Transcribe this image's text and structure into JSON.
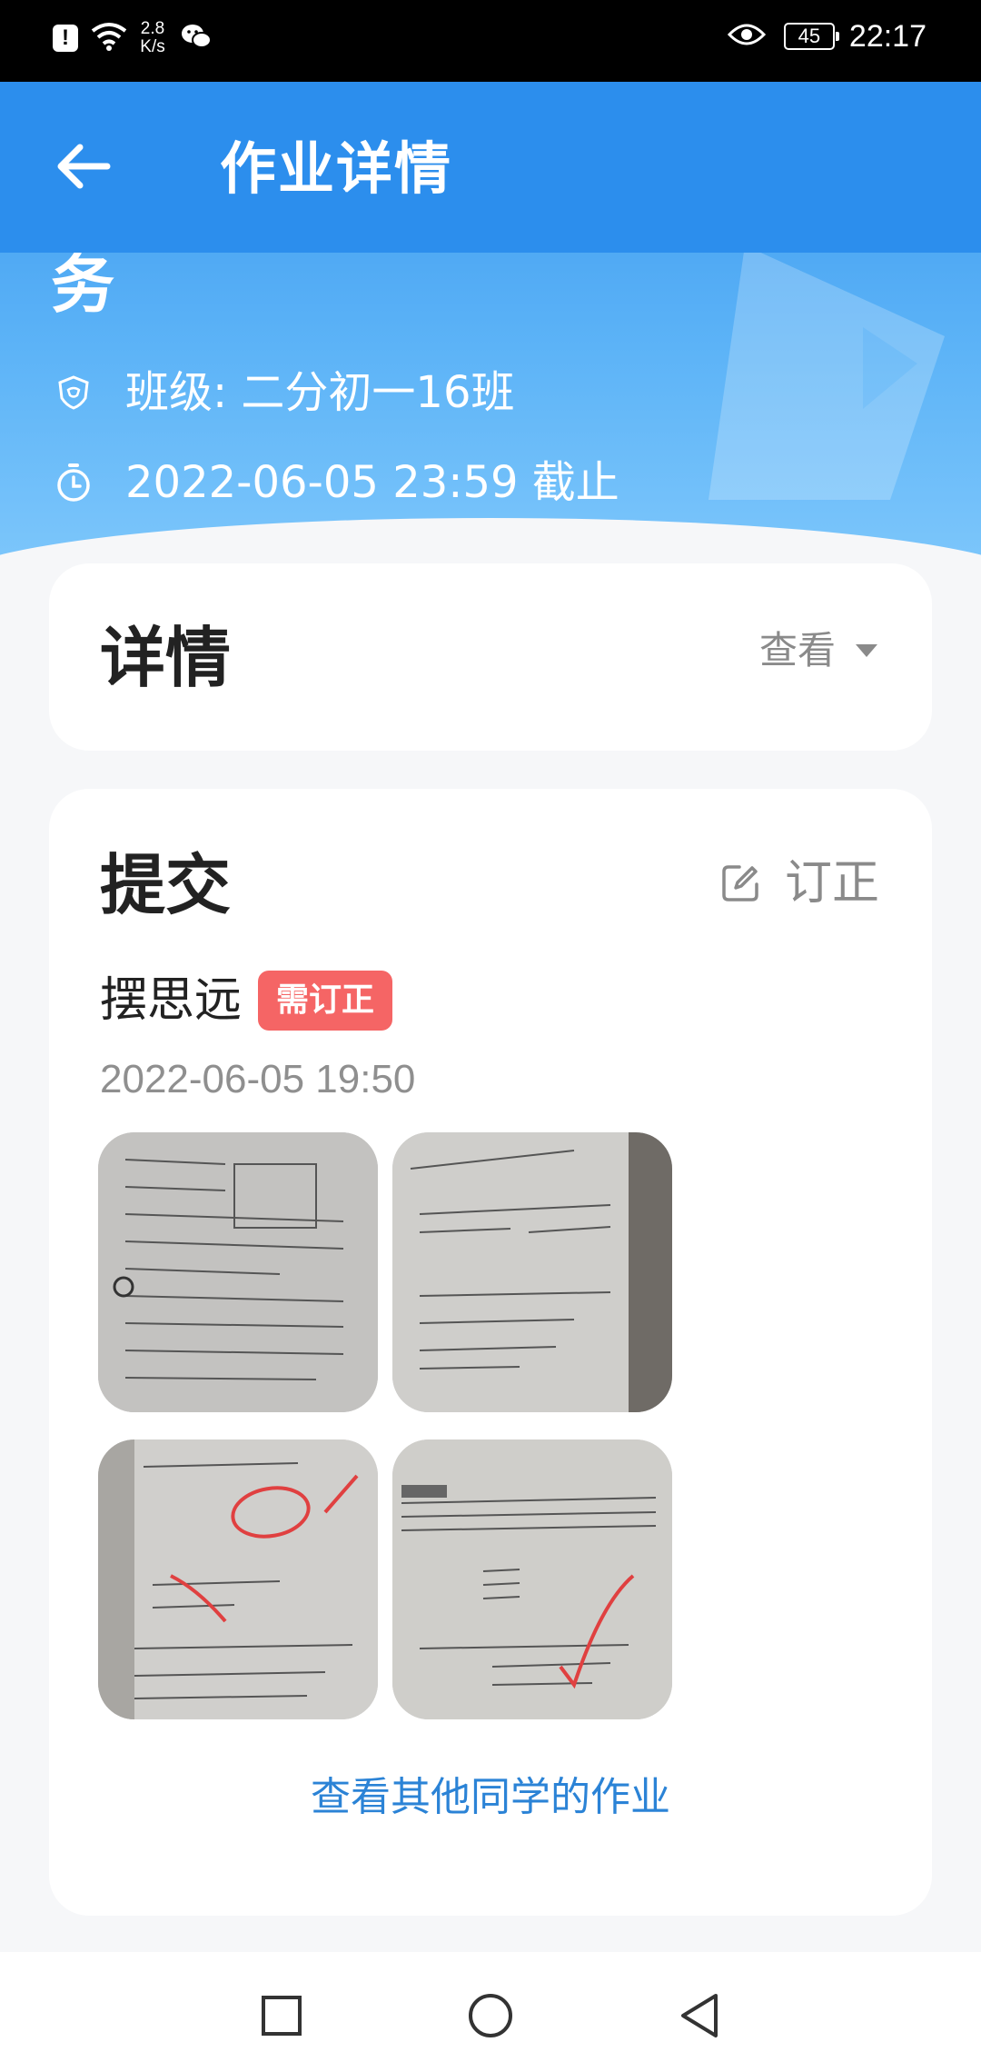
{
  "status_bar": {
    "net_speed_value": "2.8",
    "net_speed_unit": "K/s",
    "battery": "45",
    "time": "22:17"
  },
  "header": {
    "title": "作业详情",
    "hero_title_tail": "务",
    "class_label": "班级: 二分初一16班",
    "deadline": "2022-06-05 23:59 截止"
  },
  "details_card": {
    "title": "详情",
    "view_label": "查看"
  },
  "submit_card": {
    "title": "提交",
    "correct_label": "订正",
    "student_name": "摆思远",
    "badge": "需订正",
    "submit_time": "2022-06-05 19:50",
    "photos": [
      {
        "name": "homework-photo-1"
      },
      {
        "name": "homework-photo-2"
      },
      {
        "name": "homework-photo-3"
      },
      {
        "name": "homework-photo-4"
      }
    ],
    "others_link": "查看其他同学的作业"
  },
  "colors": {
    "app_bar": "#2c8eed",
    "accent_link": "#2b83d6",
    "badge_red": "#f56565"
  },
  "nav": {
    "icons": [
      "square-icon",
      "circle-icon",
      "triangle-back-icon"
    ]
  }
}
